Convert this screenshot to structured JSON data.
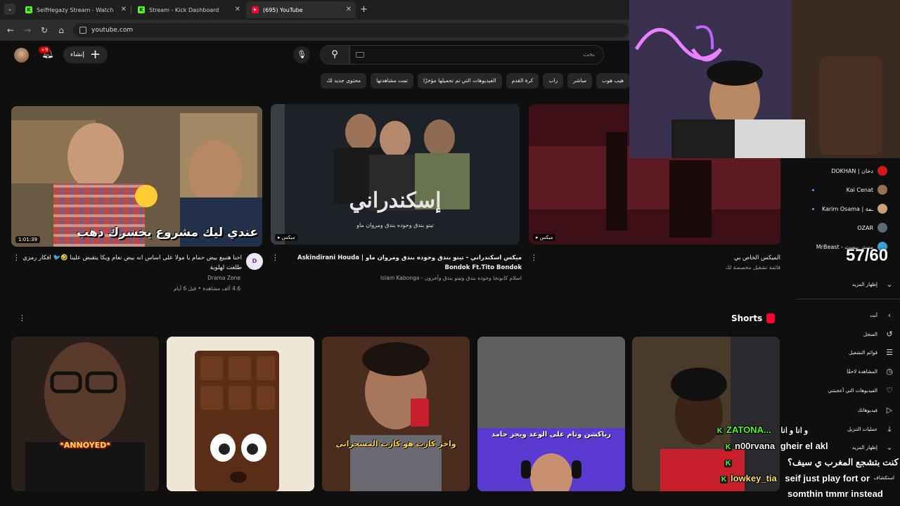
{
  "browser": {
    "tabs": [
      {
        "label": "SeifHegazy Stream - Watch Live",
        "favicon": "kick-icon",
        "active": false
      },
      {
        "label": "Stream - Kick Dashboard",
        "favicon": "kick-icon",
        "active": false
      },
      {
        "label": "(695) YouTube",
        "favicon": "youtube-icon",
        "active": true
      }
    ],
    "new_tab": "+",
    "url": "youtube.com"
  },
  "youtube": {
    "notifications_badge": "+9",
    "create_label": "إنشاء",
    "search_placeholder": "بحث",
    "chips": [
      "هيب هوب",
      "مباشر",
      "راب",
      "كرة القدم",
      "الفيديوهات التي تم تحميلها مؤخرًا",
      "تمت مشاهدتها",
      "محتوى جديد لك"
    ],
    "videos": [
      {
        "thumb_caption": "عندي ليك مشروع يخسرك دهب",
        "duration": "1:01:39",
        "title": "احنا هنبيع بيض حمام يا مولا على اساس انه بيض نعام ويكا يتقبض علينا 🤣🐦 افكار رمزي طلعت لهلوبة",
        "channel": "Drama Zone",
        "meta": "4.6 ألف مشاهدة • قبل 6 أيام",
        "avatar_text": "D"
      },
      {
        "thumb_caption": "إسكندراني",
        "thumb_subcaption": "تيتو بندق وحوده بندق ومروان ماو",
        "badge": "ميكس",
        "title": "ميكس اسكندراني - تيتو بندق وحوده بندق ومروان ماو | Askindirani Houda Bondok Ft.Tito Bondok",
        "meta": "اسلام كابونجا وحوده بندق وتيتو بندق وآخرون - Islam Kabonga"
      },
      {
        "badge": "ميكس",
        "title": "الميكس الخاص بي",
        "meta": "قائمة تشغيل مخصصة لك"
      }
    ],
    "shorts_label": "Shorts",
    "shorts": [
      {
        "caption": "*ANNOYED*"
      },
      {
        "caption": ""
      },
      {
        "caption": "واخر كارت هو كارت المسحراتي"
      },
      {
        "caption": "رياكشن وتام على الوعد ويجز جامد"
      },
      {
        "caption": ""
      }
    ]
  },
  "sidebar": {
    "subscriptions": [
      {
        "name": "DOKHAN | دخان",
        "live": true
      },
      {
        "name": "Kai Cenat",
        "live": false
      },
      {
        "name": "Karim Osama | ـمة",
        "live": false
      },
      {
        "name": "OZAR",
        "live": false
      },
      {
        "name": "MrBeast - مستر بيست",
        "live": false
      }
    ],
    "show_more": "إظهار المزيد",
    "you_label": "أنت",
    "you_items": [
      {
        "label": "السجل",
        "icon": "history-icon"
      },
      {
        "label": "قوائم التشغيل",
        "icon": "playlist-icon"
      },
      {
        "label": "المشاهدة لاحقًا",
        "icon": "clock-icon"
      },
      {
        "label": "الفيديوهات التي أعجبتني",
        "icon": "thumbs-up-icon"
      },
      {
        "label": "فيديوهاتك",
        "icon": "video-icon"
      },
      {
        "label": "عمليات التنزيل",
        "icon": "download-icon"
      },
      {
        "label": "إظهار المزيد",
        "icon": "chevron-down-icon"
      }
    ],
    "explore_label": "استكشاف"
  },
  "overlay": {
    "counter": "57/60",
    "chat": [
      {
        "user": "ZATONA...",
        "message": "و انا و انا"
      },
      {
        "user": "n00rvana",
        "message": "gheir el akl"
      },
      {
        "user": "",
        "message": "كنت بتشجع المغرب ي سيف؟"
      },
      {
        "user": "lowkey_tia",
        "message": "seif just play fort or"
      },
      {
        "user": "",
        "message": "somthin tmmr instead"
      }
    ]
  }
}
